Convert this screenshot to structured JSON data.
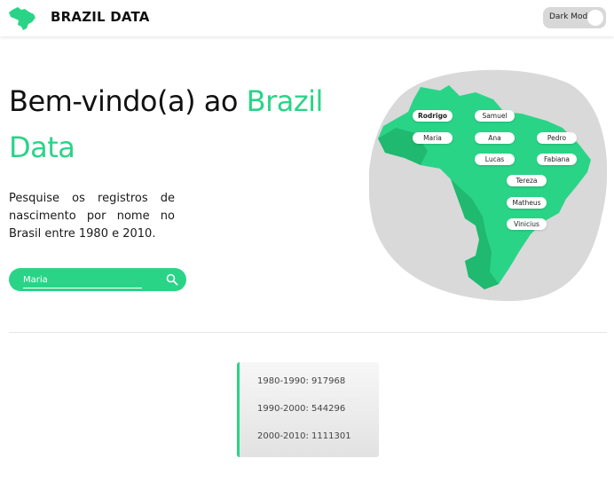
{
  "header": {
    "brand": "BRAZIL DATA",
    "dark_mode_label": "Dark Mode",
    "dark_mode_on": false
  },
  "hero": {
    "title_plain": "Bem-vindo(a) ao ",
    "title_accent_1": "Brazil",
    "title_accent_2": "Data",
    "description": "Pesquise os registros de nascimento por nome no Brasil entre 1980 e 2010."
  },
  "search": {
    "value": "Maria",
    "placeholder": "",
    "icon": "search-icon"
  },
  "map": {
    "names": [
      "Rodrigo",
      "Samuel",
      "Maria",
      "Ana",
      "Pedro",
      "Lucas",
      "Fabiana",
      "Tereza",
      "Matheus",
      "Vinicius"
    ]
  },
  "stats": {
    "rows": [
      "1980-1990: 917968",
      "1990-2000: 544296",
      "2000-2010: 1111301"
    ]
  },
  "colors": {
    "accent": "#2ad487",
    "map_dark": "#1fb96f",
    "blob": "#d9d9d9"
  }
}
